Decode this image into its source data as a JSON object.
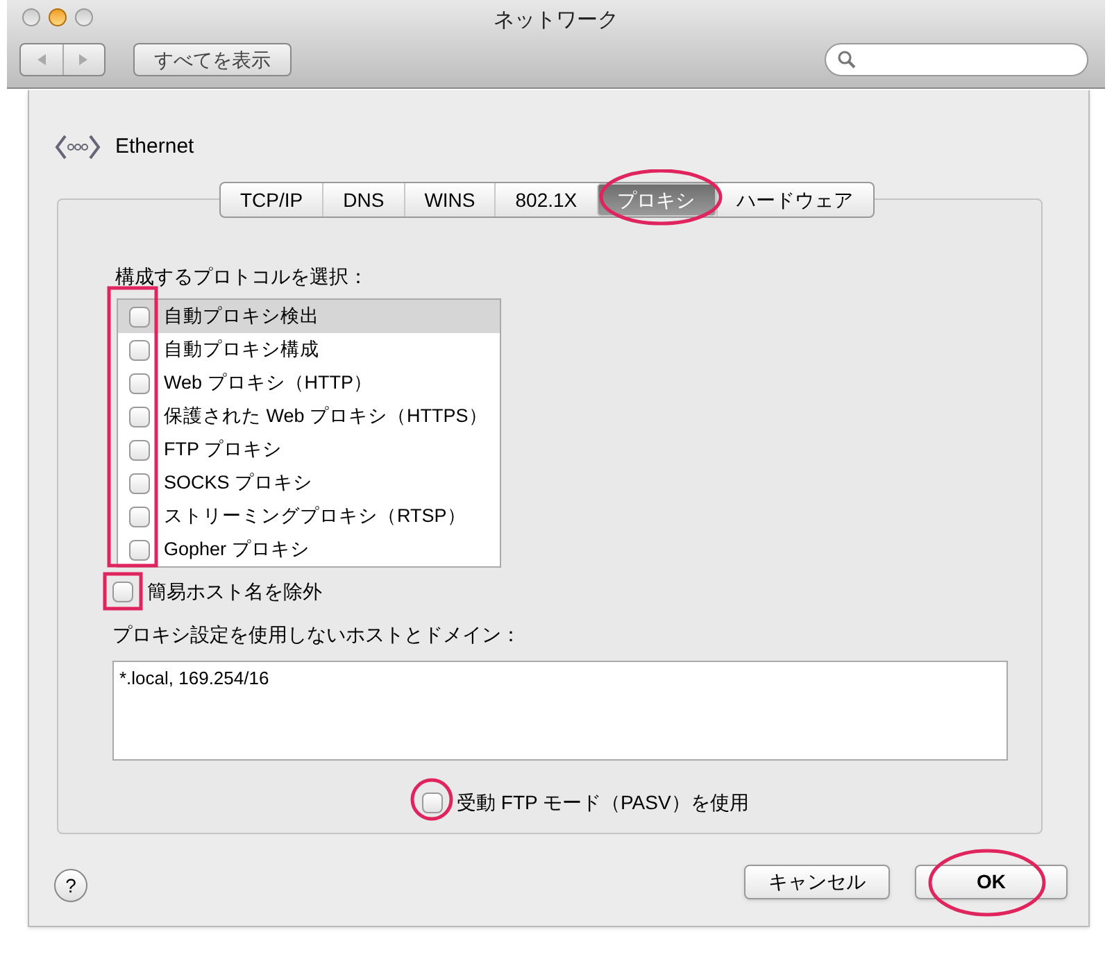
{
  "window": {
    "title": "ネットワーク",
    "show_all_button": "すべてを表示"
  },
  "interface": {
    "name": "Ethernet"
  },
  "tabs": [
    {
      "label": "TCP/IP",
      "selected": false
    },
    {
      "label": "DNS",
      "selected": false
    },
    {
      "label": "WINS",
      "selected": false
    },
    {
      "label": "802.1X",
      "selected": false
    },
    {
      "label": "プロキシ",
      "selected": true
    },
    {
      "label": "ハードウェア",
      "selected": false
    }
  ],
  "protocols": {
    "label": "構成するプロトコルを選択：",
    "items": [
      {
        "label": "自動プロキシ検出",
        "checked": false,
        "selected": true
      },
      {
        "label": "自動プロキシ構成",
        "checked": false,
        "selected": false
      },
      {
        "label": "Web プロキシ（HTTP）",
        "checked": false,
        "selected": false
      },
      {
        "label": "保護された Web プロキシ（HTTPS）",
        "checked": false,
        "selected": false
      },
      {
        "label": "FTP プロキシ",
        "checked": false,
        "selected": false
      },
      {
        "label": "SOCKS プロキシ",
        "checked": false,
        "selected": false
      },
      {
        "label": "ストリーミングプロキシ（RTSP）",
        "checked": false,
        "selected": false
      },
      {
        "label": "Gopher プロキシ",
        "checked": false,
        "selected": false
      }
    ]
  },
  "exclude_simple_hostnames": {
    "label": "簡易ホスト名を除外",
    "checked": false
  },
  "bypass": {
    "label": "プロキシ設定を使用しないホストとドメイン：",
    "value": "*.local, 169.254/16"
  },
  "passive_ftp": {
    "label": "受動 FTP モード（PASV）を使用",
    "checked": false
  },
  "help_button": "?",
  "buttons": [
    {
      "label": "キャンセル",
      "default": false
    },
    {
      "label": "OK",
      "default": true
    }
  ]
}
